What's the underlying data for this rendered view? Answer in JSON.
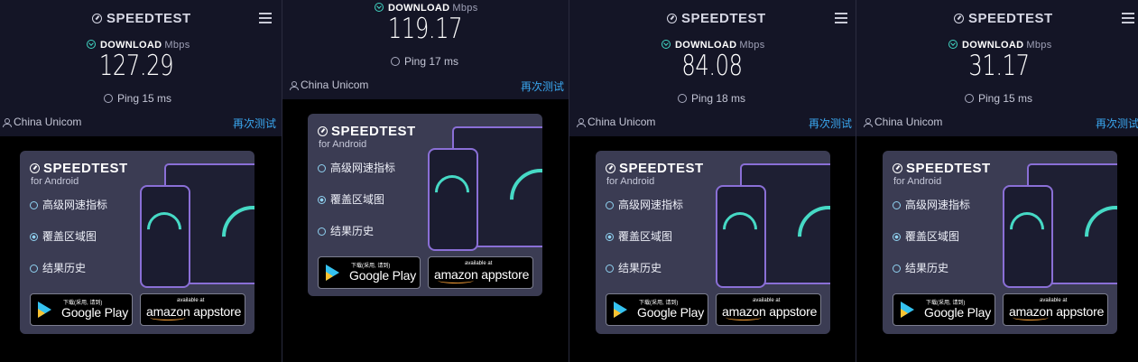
{
  "app": {
    "logo_text": "SPEEDTEST",
    "download_label": "DOWNLOAD",
    "download_unit": "Mbps",
    "retest_label": "再次测试",
    "menu_icon": "hamburger-menu-icon"
  },
  "panels": [
    {
      "download": "127.29",
      "ping": "Ping 15 ms",
      "isp": "China Unicom"
    },
    {
      "download": "119.17",
      "ping": "Ping 17 ms",
      "isp": "China Unicom"
    },
    {
      "download": "84.08",
      "ping": "Ping 18 ms",
      "isp": "China Unicom"
    },
    {
      "download": "31.17",
      "ping": "Ping 15 ms",
      "isp": "China Unicom"
    }
  ],
  "ad": {
    "title": "SPEEDTEST",
    "subtitle": "for Android",
    "features": [
      "高级网速指标",
      "覆盖区域图",
      "结果历史"
    ],
    "google_play_small": "下载(采用, 请到)",
    "google_play_big": "Google Play",
    "amazon_small": "available at",
    "amazon_big": "amazon appstore"
  },
  "colors": {
    "topbar_bg": "#141526",
    "card_bg": "#3b3c53",
    "accent_teal": "#41d6c3",
    "link_blue": "#3aa7f0",
    "device_border": "#8a6fd6"
  }
}
